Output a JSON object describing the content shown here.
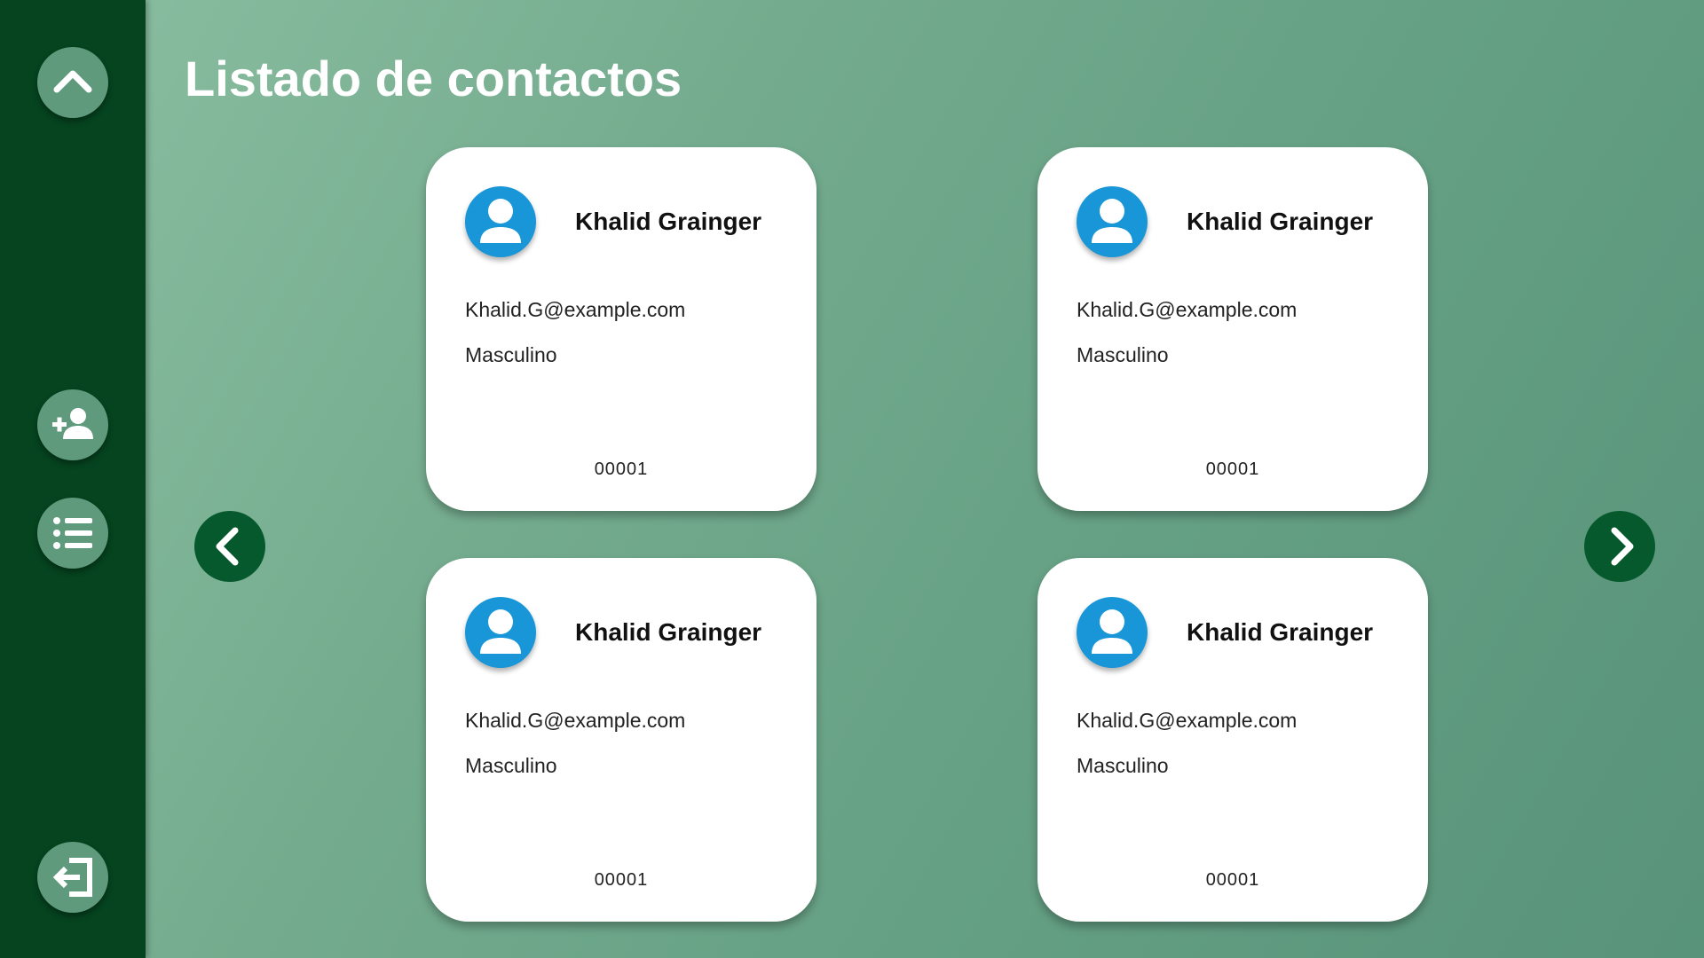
{
  "page": {
    "title": "Listado de contactos"
  },
  "sidebar": {
    "buttons": [
      {
        "icon": "chevron-up-icon"
      },
      {
        "icon": "add-person-icon"
      },
      {
        "icon": "list-icon"
      },
      {
        "icon": "logout-icon"
      }
    ]
  },
  "navigation": {
    "previous_icon": "chevron-left-icon",
    "next_icon": "chevron-right-icon"
  },
  "contacts": [
    {
      "name": "Khalid Grainger",
      "email": "Khalid.G@example.com",
      "gender": "Masculino",
      "id": "00001"
    },
    {
      "name": "Khalid Grainger",
      "email": "Khalid.G@example.com",
      "gender": "Masculino",
      "id": "00001"
    },
    {
      "name": "Khalid Grainger",
      "email": "Khalid.G@example.com",
      "gender": "Masculino",
      "id": "00001"
    },
    {
      "name": "Khalid Grainger",
      "email": "Khalid.G@example.com",
      "gender": "Masculino",
      "id": "00001"
    }
  ],
  "colors": {
    "sidebar": "#05441f",
    "sidebar_button": "#5f9a7d",
    "nav_arrow": "#06592c",
    "avatar": "#1896d8",
    "card": "#ffffff"
  }
}
